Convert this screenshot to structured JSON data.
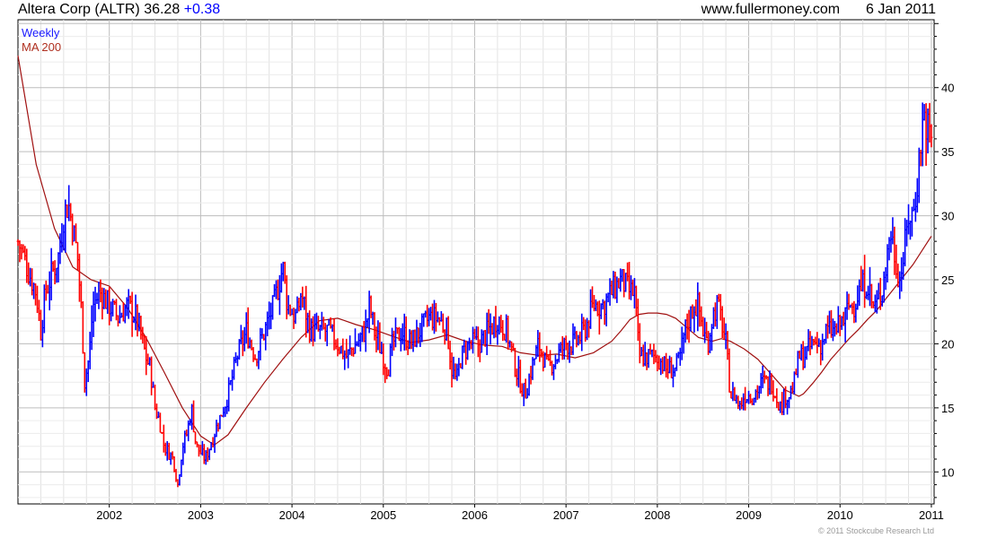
{
  "header": {
    "symbol": "Altera Corp (ALTR)",
    "price": "36.28",
    "change": "+0.38",
    "website": "www.fullermoney.com",
    "date": "6 Jan 2011"
  },
  "legend": {
    "weekly": "Weekly",
    "ma": "MA 200"
  },
  "copyright": "© 2011 Stockcube Research Ltd",
  "colors": {
    "up": "#0000ff",
    "down": "#ff0000",
    "ma": "#a01010",
    "grid": "#c8c8c8"
  },
  "chart_data": {
    "type": "line",
    "title": "Altera Corp (ALTR)",
    "xlabel": "",
    "ylabel": "",
    "xlim": [
      2001.0,
      2011.03
    ],
    "ylim": [
      7.5,
      45.3
    ],
    "x_ticks": [
      "2002",
      "2003",
      "2004",
      "2005",
      "2006",
      "2007",
      "2008",
      "2009",
      "2010",
      "2011"
    ],
    "y_ticks": [
      10,
      15,
      20,
      25,
      30,
      35,
      40
    ],
    "grid": true,
    "y_axis_side": "right",
    "series": [
      {
        "name": "Weekly",
        "style": "ohlc-bars",
        "points": [
          [
            2001.0,
            28
          ],
          [
            2001.1,
            26
          ],
          [
            2001.2,
            24
          ],
          [
            2001.25,
            21
          ],
          [
            2001.3,
            24
          ],
          [
            2001.4,
            26
          ],
          [
            2001.45,
            27
          ],
          [
            2001.5,
            30
          ],
          [
            2001.55,
            31
          ],
          [
            2001.6,
            29
          ],
          [
            2001.65,
            27
          ],
          [
            2001.7,
            22
          ],
          [
            2001.73,
            17
          ],
          [
            2001.78,
            19
          ],
          [
            2001.82,
            23
          ],
          [
            2001.9,
            24
          ],
          [
            2002.0,
            23
          ],
          [
            2002.1,
            22
          ],
          [
            2002.2,
            23
          ],
          [
            2002.3,
            22
          ],
          [
            2002.4,
            19
          ],
          [
            2002.45,
            18
          ],
          [
            2002.5,
            15
          ],
          [
            2002.55,
            14
          ],
          [
            2002.6,
            12
          ],
          [
            2002.7,
            11
          ],
          [
            2002.75,
            9
          ],
          [
            2002.8,
            12
          ],
          [
            2002.85,
            13
          ],
          [
            2002.9,
            15
          ],
          [
            2002.95,
            12
          ],
          [
            2003.05,
            11
          ],
          [
            2003.1,
            12
          ],
          [
            2003.2,
            14
          ],
          [
            2003.3,
            16
          ],
          [
            2003.4,
            19
          ],
          [
            2003.5,
            21
          ],
          [
            2003.6,
            19
          ],
          [
            2003.7,
            21
          ],
          [
            2003.8,
            23
          ],
          [
            2003.9,
            26
          ],
          [
            2003.95,
            23
          ],
          [
            2004.05,
            22
          ],
          [
            2004.1,
            24
          ],
          [
            2004.2,
            21
          ],
          [
            2004.3,
            21
          ],
          [
            2004.4,
            21
          ],
          [
            2004.5,
            20
          ],
          [
            2004.6,
            19
          ],
          [
            2004.7,
            20
          ],
          [
            2004.8,
            21
          ],
          [
            2004.85,
            23
          ],
          [
            2004.9,
            21
          ],
          [
            2005.0,
            19
          ],
          [
            2005.05,
            18
          ],
          [
            2005.1,
            20
          ],
          [
            2005.2,
            21
          ],
          [
            2005.3,
            20
          ],
          [
            2005.4,
            21
          ],
          [
            2005.5,
            22
          ],
          [
            2005.6,
            22
          ],
          [
            2005.7,
            21
          ],
          [
            2005.75,
            18
          ],
          [
            2005.8,
            17
          ],
          [
            2005.85,
            19
          ],
          [
            2005.95,
            20
          ],
          [
            2006.05,
            20
          ],
          [
            2006.15,
            21
          ],
          [
            2006.25,
            22
          ],
          [
            2006.35,
            21
          ],
          [
            2006.45,
            18
          ],
          [
            2006.55,
            16
          ],
          [
            2006.62,
            18
          ],
          [
            2006.7,
            20
          ],
          [
            2006.8,
            18
          ],
          [
            2006.9,
            19
          ],
          [
            2007.0,
            20
          ],
          [
            2007.1,
            20
          ],
          [
            2007.2,
            21
          ],
          [
            2007.3,
            23
          ],
          [
            2007.4,
            23
          ],
          [
            2007.5,
            24
          ],
          [
            2007.6,
            25
          ],
          [
            2007.7,
            24
          ],
          [
            2007.75,
            24
          ],
          [
            2007.8,
            19
          ],
          [
            2007.9,
            19
          ],
          [
            2008.0,
            19
          ],
          [
            2008.1,
            18
          ],
          [
            2008.2,
            18
          ],
          [
            2008.25,
            19
          ],
          [
            2008.3,
            21
          ],
          [
            2008.4,
            23
          ],
          [
            2008.45,
            23
          ],
          [
            2008.5,
            21
          ],
          [
            2008.55,
            20
          ],
          [
            2008.6,
            22
          ],
          [
            2008.65,
            23
          ],
          [
            2008.7,
            22
          ],
          [
            2008.75,
            20
          ],
          [
            2008.8,
            16
          ],
          [
            2008.85,
            16
          ],
          [
            2008.9,
            15
          ],
          [
            2008.95,
            16
          ],
          [
            2009.05,
            16
          ],
          [
            2009.15,
            17
          ],
          [
            2009.25,
            17
          ],
          [
            2009.3,
            16
          ],
          [
            2009.35,
            15
          ],
          [
            2009.4,
            16
          ],
          [
            2009.45,
            16
          ],
          [
            2009.5,
            17
          ],
          [
            2009.55,
            19
          ],
          [
            2009.6,
            19
          ],
          [
            2009.7,
            20
          ],
          [
            2009.8,
            20
          ],
          [
            2009.85,
            21
          ],
          [
            2009.9,
            21
          ],
          [
            2009.95,
            21
          ],
          [
            2010.05,
            22
          ],
          [
            2010.1,
            23
          ],
          [
            2010.15,
            23
          ],
          [
            2010.2,
            24
          ],
          [
            2010.3,
            25
          ],
          [
            2010.35,
            23
          ],
          [
            2010.4,
            23
          ],
          [
            2010.45,
            24
          ],
          [
            2010.5,
            26
          ],
          [
            2010.55,
            29
          ],
          [
            2010.6,
            27
          ],
          [
            2010.65,
            25
          ],
          [
            2010.7,
            27
          ],
          [
            2010.75,
            30
          ],
          [
            2010.8,
            30
          ],
          [
            2010.85,
            33
          ],
          [
            2010.9,
            37
          ],
          [
            2010.92,
            38
          ],
          [
            2010.95,
            37
          ],
          [
            2011.0,
            36
          ]
        ]
      },
      {
        "name": "MA 200",
        "style": "line",
        "points": [
          [
            2001.0,
            42.5
          ],
          [
            2001.2,
            34
          ],
          [
            2001.4,
            29
          ],
          [
            2001.6,
            26
          ],
          [
            2001.8,
            25
          ],
          [
            2002.0,
            24.5
          ],
          [
            2002.2,
            22.8
          ],
          [
            2002.4,
            20.5
          ],
          [
            2002.6,
            17.8
          ],
          [
            2002.8,
            15
          ],
          [
            2003.0,
            12.8
          ],
          [
            2003.15,
            12.1
          ],
          [
            2003.3,
            12.9
          ],
          [
            2003.5,
            15
          ],
          [
            2003.7,
            17
          ],
          [
            2003.9,
            18.8
          ],
          [
            2004.1,
            20.5
          ],
          [
            2004.3,
            21.8
          ],
          [
            2004.5,
            22
          ],
          [
            2004.7,
            21.5
          ],
          [
            2004.9,
            21.1
          ],
          [
            2005.1,
            20.6
          ],
          [
            2005.3,
            20.1
          ],
          [
            2005.5,
            20.3
          ],
          [
            2005.7,
            20.7
          ],
          [
            2005.9,
            20.2
          ],
          [
            2006.1,
            19.9
          ],
          [
            2006.3,
            19.8
          ],
          [
            2006.5,
            19.3
          ],
          [
            2006.7,
            19.1
          ],
          [
            2006.9,
            19.2
          ],
          [
            2007.1,
            18.9
          ],
          [
            2007.3,
            19.3
          ],
          [
            2007.5,
            20.2
          ],
          [
            2007.6,
            21
          ],
          [
            2007.7,
            21.9
          ],
          [
            2007.8,
            22.3
          ],
          [
            2007.9,
            22.4
          ],
          [
            2008.0,
            22.4
          ],
          [
            2008.1,
            22.3
          ],
          [
            2008.2,
            22
          ],
          [
            2008.3,
            21.4
          ],
          [
            2008.45,
            20.5
          ],
          [
            2008.6,
            20.2
          ],
          [
            2008.7,
            20.4
          ],
          [
            2008.8,
            20.2
          ],
          [
            2008.95,
            19.6
          ],
          [
            2009.1,
            18.8
          ],
          [
            2009.25,
            17.6
          ],
          [
            2009.4,
            16.4
          ],
          [
            2009.55,
            15.9
          ],
          [
            2009.6,
            16.1
          ],
          [
            2009.7,
            16.9
          ],
          [
            2009.8,
            17.8
          ],
          [
            2009.9,
            18.8
          ],
          [
            2010.0,
            19.6
          ],
          [
            2010.1,
            20.4
          ],
          [
            2010.2,
            21.1
          ],
          [
            2010.3,
            21.9
          ],
          [
            2010.4,
            22.6
          ],
          [
            2010.5,
            23.5
          ],
          [
            2010.6,
            24.4
          ],
          [
            2010.7,
            25.3
          ],
          [
            2010.8,
            26.2
          ],
          [
            2010.9,
            27.3
          ],
          [
            2011.0,
            28.4
          ]
        ]
      }
    ]
  }
}
